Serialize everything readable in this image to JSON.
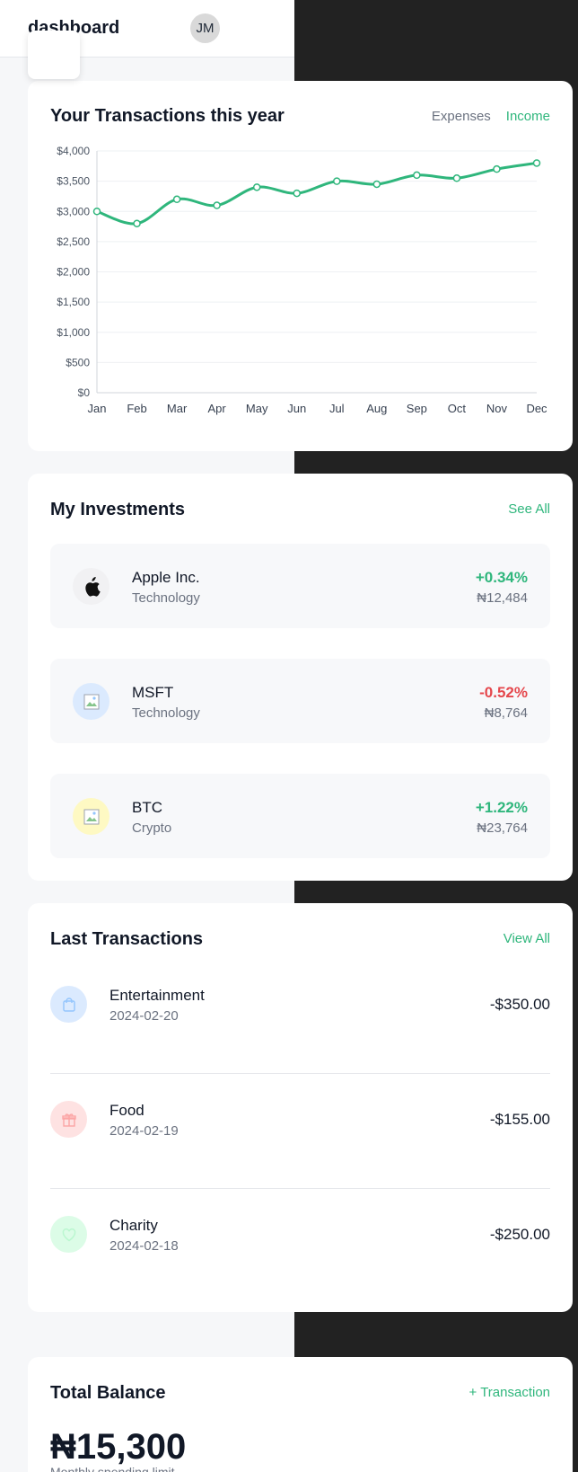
{
  "header": {
    "title": "dashboard",
    "avatar_initials": "JM"
  },
  "colors": {
    "accent": "#2fb67c",
    "negative": "#e5484d",
    "dark_panel": "#222222"
  },
  "transactions_chart": {
    "title": "Your Transactions this year",
    "toggle_expenses": "Expenses",
    "toggle_income": "Income"
  },
  "chart_data": {
    "type": "line",
    "title": "",
    "categories": [
      "Jan",
      "Feb",
      "Mar",
      "Apr",
      "May",
      "Jun",
      "Jul",
      "Aug",
      "Sep",
      "Oct",
      "Nov",
      "Dec"
    ],
    "series": [
      {
        "values": [
          3000,
          2800,
          3200,
          3100,
          3400,
          3300,
          3500,
          3450,
          3600,
          3550,
          3700,
          3800
        ]
      }
    ],
    "ylim": [
      0,
      4000
    ],
    "yticks": [
      0,
      500,
      1000,
      1500,
      2000,
      2500,
      3000,
      3500,
      4000
    ],
    "ytick_labels": [
      "$0",
      "$500",
      "$1,000",
      "$1,500",
      "$2,000",
      "$2,500",
      "$3,000",
      "$3,500",
      "$4,000"
    ],
    "grid": true,
    "color": "#2fb67c"
  },
  "investments": {
    "title": "My Investments",
    "see_all": "See All",
    "items": [
      {
        "name": "Apple Inc.",
        "category": "Technology",
        "change": "+0.34%",
        "amount": "₦12,484",
        "icon": "apple-icon"
      },
      {
        "name": "MSFT",
        "category": "Technology",
        "change": "-0.52%",
        "amount": "₦8,764",
        "icon": "broken-image-icon"
      },
      {
        "name": "BTC",
        "category": "Crypto",
        "change": "+1.22%",
        "amount": "₦23,764",
        "icon": "broken-image-icon"
      }
    ]
  },
  "last_transactions": {
    "title": "Last Transactions",
    "view_all": "View All",
    "items": [
      {
        "name": "Entertainment",
        "date": "2024-02-20",
        "amount": "-$350.00",
        "icon": "shopping-bag-icon"
      },
      {
        "name": "Food",
        "date": "2024-02-19",
        "amount": "-$155.00",
        "icon": "gift-icon"
      },
      {
        "name": "Charity",
        "date": "2024-02-18",
        "amount": "-$250.00",
        "icon": "heart-icon"
      }
    ]
  },
  "balance": {
    "title": "Total Balance",
    "add_transaction": "+ Transaction",
    "amount": "₦15,300",
    "limit_label": "Monthly spending limit"
  }
}
